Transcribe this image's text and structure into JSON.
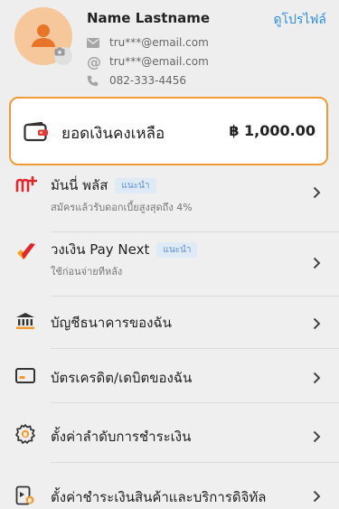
{
  "profile": {
    "name": "Name Lastname",
    "edit_label": "ดูโปรไฟล์",
    "email": "tru***@email.com",
    "alt_email": "tru***@email.com",
    "phone": "082-333-4456",
    "avatar_color": "#f5c79b",
    "accent": "#e8742a"
  },
  "balance": {
    "label": "ยอดเงินคงเหลือ",
    "amount": "฿ 1,000.00",
    "border_color": "#f29a33"
  },
  "menu": [
    {
      "title": "มันนี่ พลัส",
      "badge": "แนะนำ",
      "sub": "สมัครแล้วรับดอกเบี้ยสูงสุดถึง 4%",
      "icon": "money-plus-icon"
    },
    {
      "title": "วงเงิน Pay Next",
      "badge": "แนะนำ",
      "sub": "ใช้ก่อนจ่ายทีหลัง",
      "icon": "pay-next-icon"
    },
    {
      "title": "บัญชีธนาคารของฉัน",
      "icon": "bank-icon"
    },
    {
      "title": "บัตรเครดิต/เดบิตของฉัน",
      "icon": "card-icon"
    },
    {
      "title": "ตั้งค่าลำดับการชำระเงิน",
      "icon": "payment-settings-icon"
    },
    {
      "title": "ตั้งค่าชำระเงินสินค้าและบริการดิจิทัล",
      "icon": "digital-payment-icon"
    }
  ]
}
